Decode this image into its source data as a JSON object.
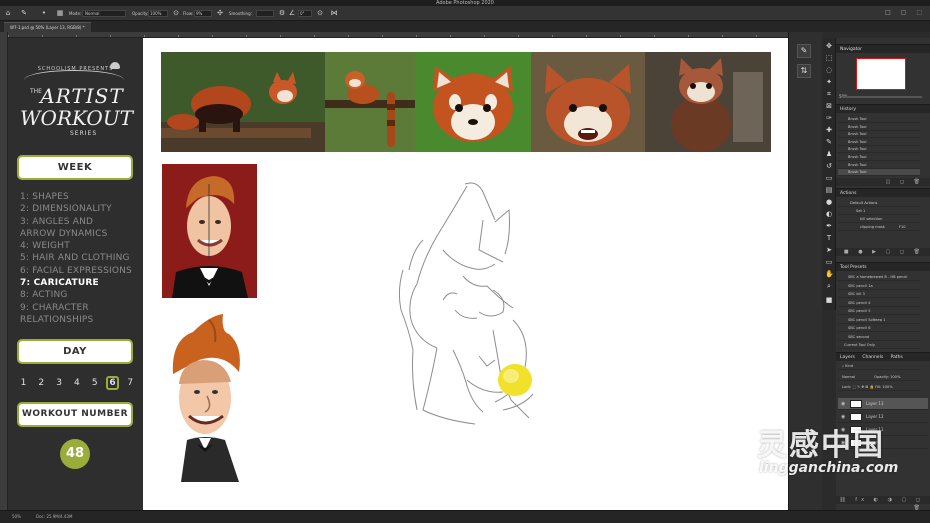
{
  "app": {
    "window_title": "Adobe Photoshop 2020",
    "document_tab": "W7-1.psd @ 50% (Layer 13, RGB/8) *"
  },
  "options_bar": {
    "mode_label": "Mode:",
    "mode_value": "Normal",
    "opacity_label": "Opacity:",
    "opacity_value": "100%",
    "flow_label": "Flow:",
    "flow_value": "9%",
    "smoothing_label": "Smoothing:",
    "angle_value": "0°"
  },
  "course": {
    "presents": "SCHOOLISM PRESENTS",
    "the": "THE",
    "artist": "ARTIST",
    "workout": "WORKOUT",
    "series": "SERIES",
    "week_label": "WEEK",
    "weeks": [
      {
        "text": "1:   SHAPES",
        "active": false
      },
      {
        "text": "2: DIMENSIONALITY",
        "active": false
      },
      {
        "text": "3: ANGLES AND",
        "active": false
      },
      {
        "text": "     ARROW DYNAMICS",
        "active": false
      },
      {
        "text": "4: WEIGHT",
        "active": false
      },
      {
        "text": "5: HAIR AND CLOTHING",
        "active": false
      },
      {
        "text": "6: FACIAL EXPRESSIONS",
        "active": false
      },
      {
        "text": "7: CARICATURE",
        "active": true
      },
      {
        "text": "8: ACTING",
        "active": false
      },
      {
        "text": "9: CHARACTER",
        "active": false
      },
      {
        "text": "     RELATIONSHIPS",
        "active": false
      }
    ],
    "day_label": "DAY",
    "days": [
      "1",
      "2",
      "3",
      "4",
      "5",
      "6",
      "7"
    ],
    "active_day": "6",
    "workout_label": "WORKOUT NUMBER",
    "workout_number": "48"
  },
  "panels": {
    "navigator_title": "Navigator",
    "navigator_zoom": "50%",
    "history_title": "History",
    "history_items": [
      "Brush Tool",
      "Brush Tool",
      "Brush Tool",
      "Brush Tool",
      "Brush Tool",
      "Brush Tool",
      "Brush Tool",
      "Brush Tool"
    ],
    "actions_title": "Actions",
    "actions_items": [
      "Default Actions",
      "Set 1",
      "kill selection",
      "clipping mask"
    ],
    "actions_f_key": "F10",
    "tool_presets_title": "Tool Presets",
    "tool_presets": [
      "SBC a homebrewed B - HB pencil",
      "SBC pencil 1a",
      "SBC kill 3",
      "SBC pencil 4",
      "SBC pencil 5",
      "SBC pencil Softeep 1",
      "SBC pencil 6",
      "SBC second"
    ],
    "current_tool_only": "Current Tool Only",
    "layers_tabs": [
      "Layers",
      "Channels",
      "Paths"
    ],
    "layers_kind": "Kind",
    "blend_mode": "Normal",
    "opacity_label": "Opacity:",
    "opacity_value": "100%",
    "lock_label": "Lock:",
    "fill_label": "Fill:",
    "fill_value": "100%",
    "layers": [
      {
        "name": "Layer 13",
        "selected": true
      },
      {
        "name": "Layer 12",
        "selected": false
      },
      {
        "name": "Layer 11",
        "selected": false
      },
      {
        "name": "Layer 1",
        "selected": false
      }
    ]
  },
  "status": {
    "zoom": "50%",
    "doc_info": "Doc: 25.9M/4.43M"
  },
  "watermark": {
    "cn": "灵感中国",
    "en": "lingganchina.com"
  }
}
